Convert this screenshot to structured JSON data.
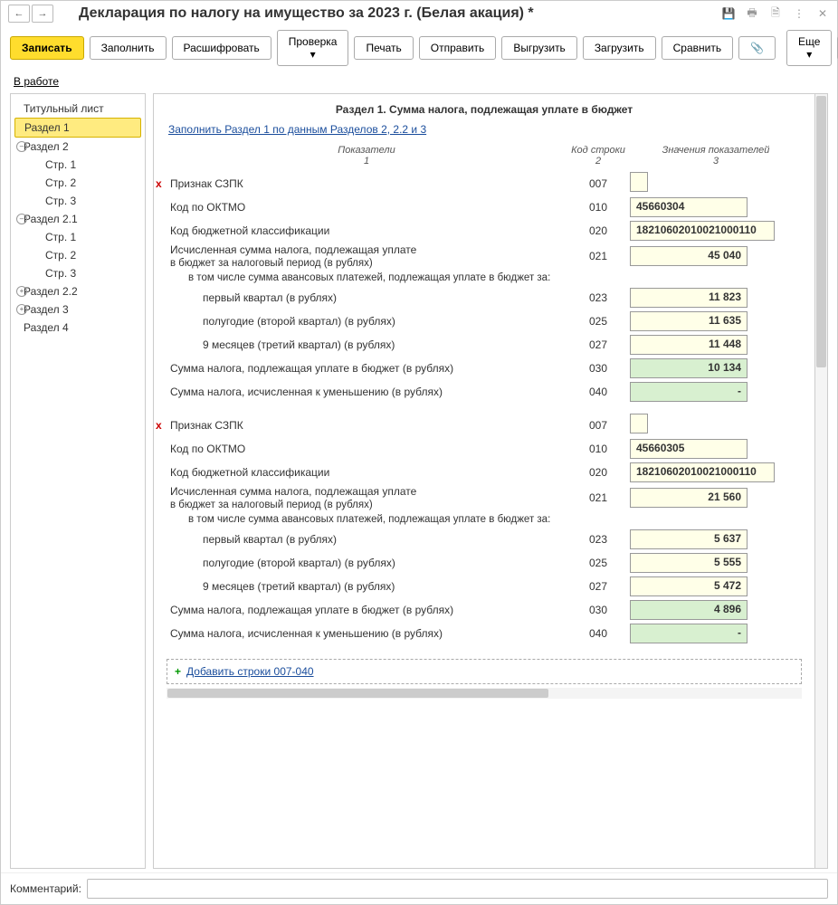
{
  "header": {
    "title": "Декларация по налогу на имущество за 2023 г. (Белая акация) *"
  },
  "toolbar": {
    "save": "Записать",
    "fill": "Заполнить",
    "decrypt": "Расшифровать",
    "check": "Проверка",
    "print": "Печать",
    "send": "Отправить",
    "upload": "Выгрузить",
    "download": "Загрузить",
    "compare": "Сравнить",
    "more": "Еще",
    "help": "?"
  },
  "status": "В работе",
  "tree": {
    "n0": "Титульный лист",
    "n1": "Раздел 1",
    "n2": "Раздел 2",
    "n2_1": "Стр. 1",
    "n2_2": "Стр. 2",
    "n2_3": "Стр. 3",
    "n21": "Раздел 2.1",
    "n21_1": "Стр. 1",
    "n21_2": "Стр. 2",
    "n21_3": "Стр. 3",
    "n22": "Раздел 2.2",
    "n3": "Раздел 3",
    "n4": "Раздел 4"
  },
  "content": {
    "section_title": "Раздел 1. Сумма налога, подлежащая уплате в бюджет",
    "fill_link": "Заполнить Раздел 1 по данным Разделов 2, 2.2 и 3",
    "headers": {
      "ind": "Показатели",
      "ind_n": "1",
      "code": "Код строки",
      "code_n": "2",
      "val": "Значения показателей",
      "val_n": "3"
    },
    "labels": {
      "szpk": "Признак СЗПК",
      "oktmo": "Код по ОКТМО",
      "kbk": "Код бюджетной классификации",
      "calc_tax": "Исчисленная сумма налога, подлежащая уплате",
      "calc_tax2": "в бюджет за налоговый период (в рублях)",
      "advances": "в том числе сумма авансовых платежей, подлежащая уплате в бюджет за:",
      "q1": "первый квартал (в рублях)",
      "q2": "полугодие (второй квартал) (в рублях)",
      "q3": "9 месяцев (третий квартал) (в рублях)",
      "topay": "Сумма налога, подлежащая уплате в бюджет (в рублях)",
      "reduce": "Сумма налога, исчисленная к уменьшению (в рублях)"
    },
    "codes": {
      "szpk": "007",
      "oktmo": "010",
      "kbk": "020",
      "calc": "021",
      "q1": "023",
      "q2": "025",
      "q3": "027",
      "topay": "030",
      "reduce": "040"
    },
    "blocks": [
      {
        "oktmo": "45660304",
        "kbk": "18210602010021000110",
        "calc": "45 040",
        "q1": "11 823",
        "q2": "11 635",
        "q3": "11 448",
        "topay": "10 134",
        "reduce": "-"
      },
      {
        "oktmo": "45660305",
        "kbk": "18210602010021000110",
        "calc": "21 560",
        "q1": "5 637",
        "q2": "5 555",
        "q3": "5 472",
        "topay": "4 896",
        "reduce": "-"
      }
    ],
    "add_rows": "Добавить строки 007-040"
  },
  "footer": {
    "label": "Комментарий:"
  }
}
